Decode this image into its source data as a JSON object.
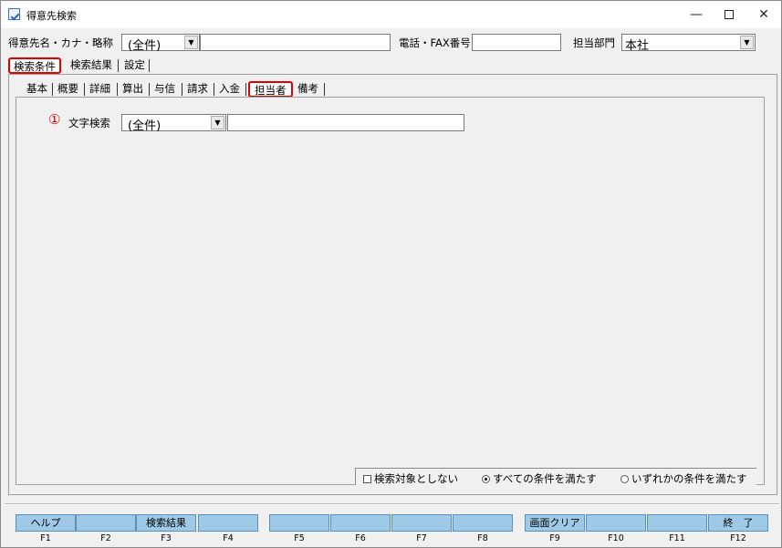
{
  "window": {
    "title": "得意先検索"
  },
  "search": {
    "name_label": "得意先名・カナ・略称",
    "name_mode": "(全件)",
    "name_value": "",
    "phone_label": "電話・FAX番号",
    "phone_value": "",
    "dept_label": "担当部門",
    "dept_value": "本社"
  },
  "main_tabs": [
    {
      "label": "検索条件",
      "active": true
    },
    {
      "label": "検索結果",
      "active": false
    },
    {
      "label": "設定",
      "active": false
    }
  ],
  "sub_tabs": [
    {
      "label": "基本",
      "active": false
    },
    {
      "label": "概要",
      "active": false
    },
    {
      "label": "詳細",
      "active": false
    },
    {
      "label": "算出",
      "active": false
    },
    {
      "label": "与信",
      "active": false
    },
    {
      "label": "請求",
      "active": false
    },
    {
      "label": "入金",
      "active": false
    },
    {
      "label": "担当者",
      "active": true
    },
    {
      "label": "備考",
      "active": false
    }
  ],
  "text_search": {
    "marker": "①",
    "label": "文字検索",
    "mode": "(全件)",
    "value": ""
  },
  "options": {
    "exclude_label": "検索対象としない",
    "exclude_checked": false,
    "all_label": "すべての条件を満たす",
    "all_selected": true,
    "any_label": "いずれかの条件を満たす",
    "any_selected": false
  },
  "fkeys": [
    {
      "label": "ヘルプ",
      "key": "F1"
    },
    {
      "label": "",
      "key": "F2"
    },
    {
      "label": "検索結果",
      "key": "F3"
    },
    {
      "label": "",
      "key": "F4"
    },
    {
      "label": "",
      "key": "F5"
    },
    {
      "label": "",
      "key": "F6"
    },
    {
      "label": "",
      "key": "F7"
    },
    {
      "label": "",
      "key": "F8"
    },
    {
      "label": "画面クリア",
      "key": "F9"
    },
    {
      "label": "",
      "key": "F10"
    },
    {
      "label": "",
      "key": "F11"
    },
    {
      "label": "終　了",
      "key": "F12"
    }
  ],
  "colors": {
    "highlight": "#e00000",
    "fkey_bg": "#9ecae8"
  }
}
